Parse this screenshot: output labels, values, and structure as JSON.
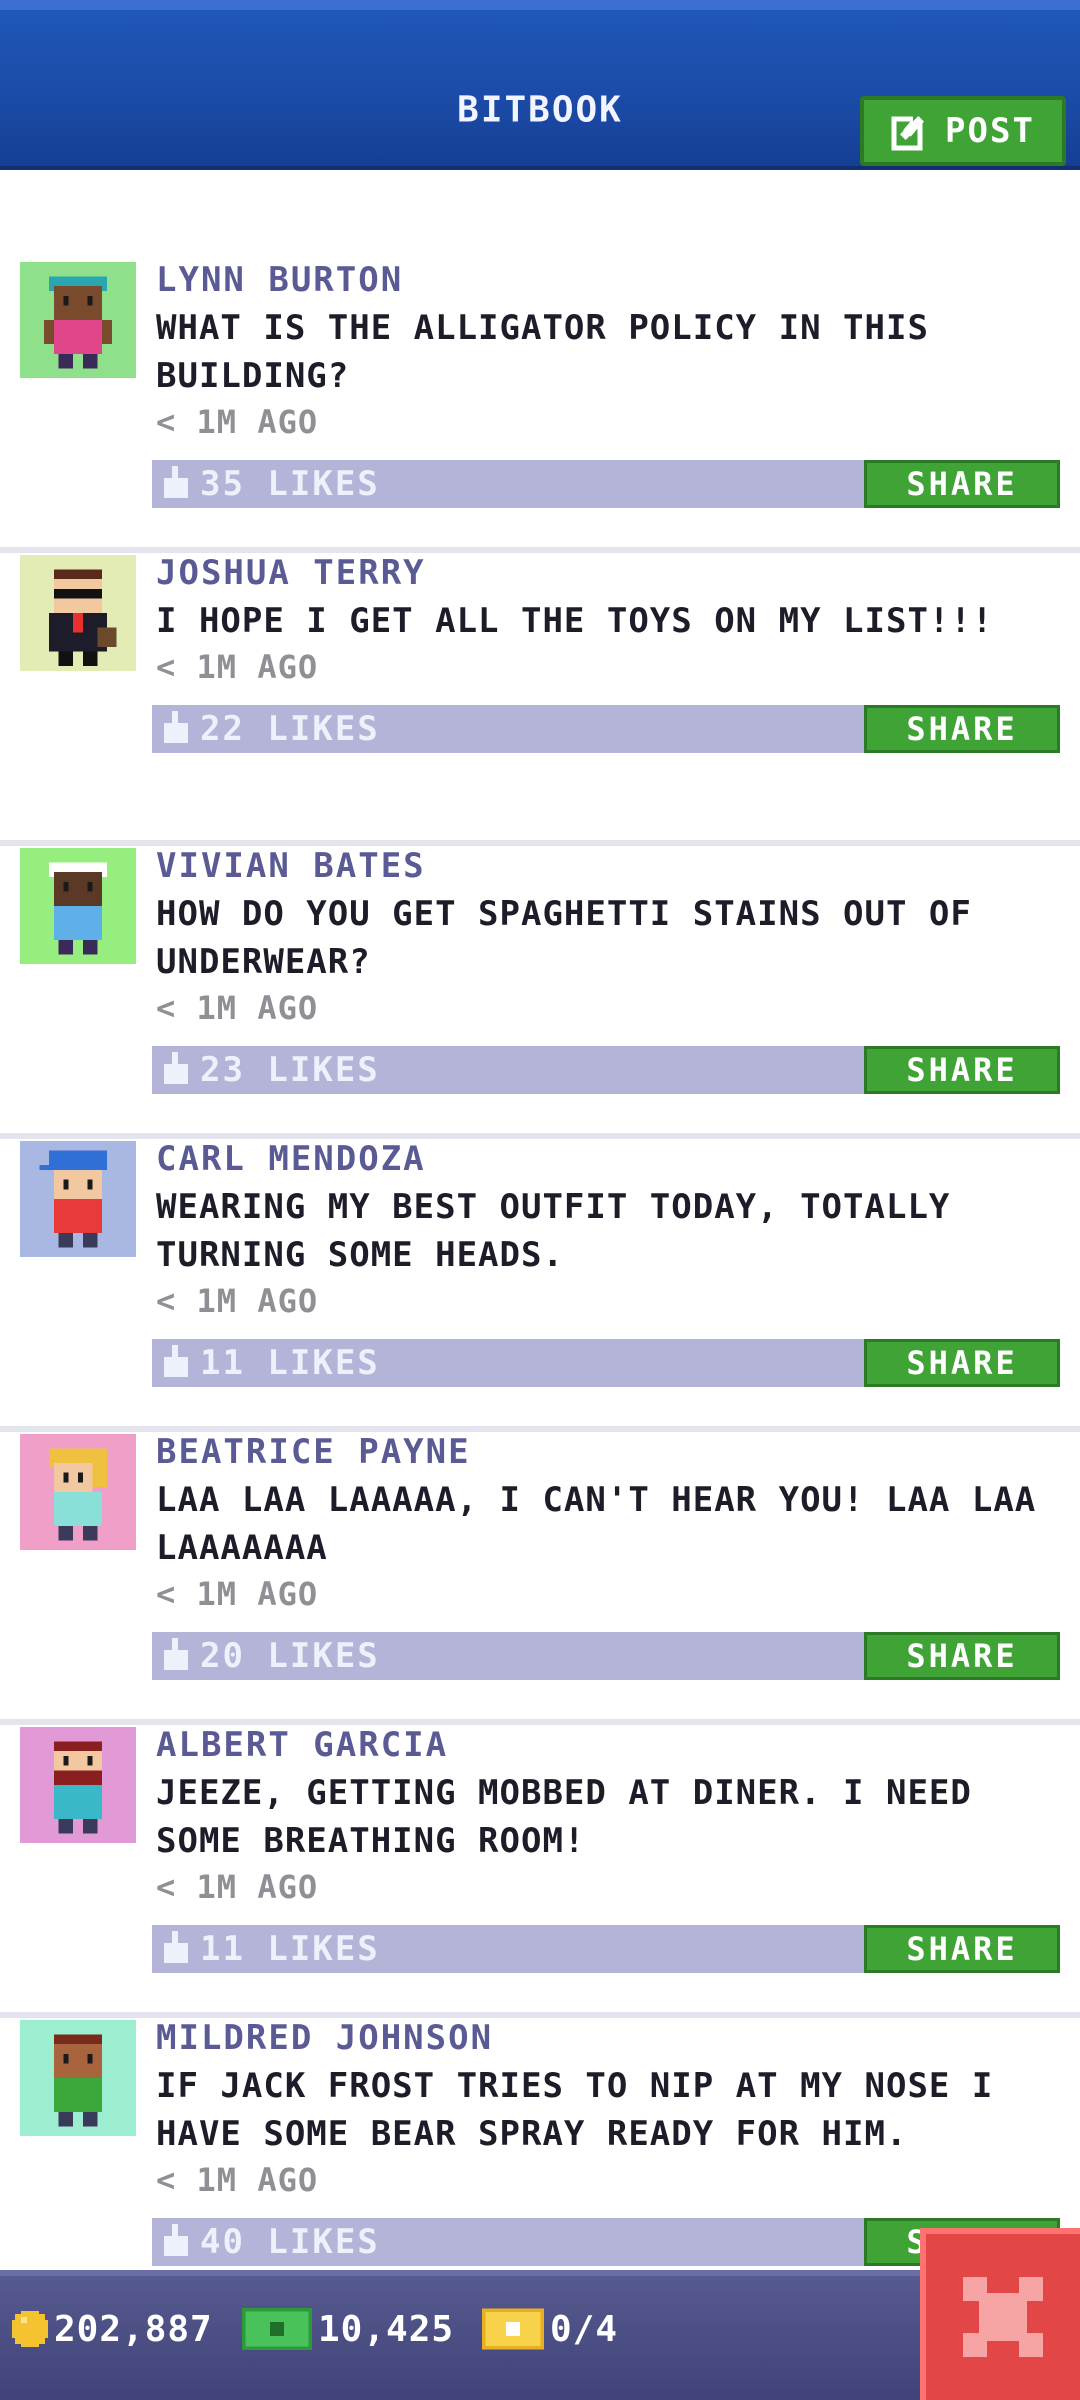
{
  "header": {
    "title": "BITBOOK",
    "post_label": "POST"
  },
  "colors": {
    "header_blue": "#1b4aa6",
    "green": "#3fa336",
    "likes_bar": "#b3b4d8",
    "close_red": "#e24646"
  },
  "posts": [
    {
      "author": "LYNN BURTON",
      "message": "WHAT IS THE ALLIGATOR POLICY IN THIS BUILDING?",
      "time": "< 1M AGO",
      "likes": "35 LIKES",
      "share": "SHARE",
      "avatar_bg": "#8fe08a",
      "avatar_icon": "woman-pink-shirt-avatar"
    },
    {
      "author": "JOSHUA TERRY",
      "message": "I HOPE I GET ALL THE TOYS ON MY LIST!!!",
      "time": "< 1M AGO",
      "likes": "22 LIKES",
      "share": "SHARE",
      "avatar_bg": "#e2ecb4",
      "avatar_icon": "man-sunglasses-suit-avatar"
    },
    {
      "author": "VIVIAN BATES",
      "message": "HOW DO YOU GET SPAGHETTI STAINS OUT OF UNDERWEAR?",
      "time": "< 1M AGO",
      "likes": "23 LIKES",
      "share": "SHARE",
      "avatar_bg": "#95ee7e",
      "avatar_icon": "woman-headband-avatar"
    },
    {
      "author": "CARL MENDOZA",
      "message": "WEARING MY BEST OUTFIT TODAY, TOTALLY TURNING SOME HEADS.",
      "time": "< 1M AGO",
      "likes": "11 LIKES",
      "share": "SHARE",
      "avatar_bg": "#a9b7e3",
      "avatar_icon": "man-blue-cap-avatar"
    },
    {
      "author": "BEATRICE PAYNE",
      "message": "LAA LAA LAAAAA, I CAN'T HEAR YOU! LAA LAA LAAAAAAA",
      "time": "< 1M AGO",
      "likes": "20 LIKES",
      "share": "SHARE",
      "avatar_bg": "#f0a0c8",
      "avatar_icon": "woman-blonde-avatar"
    },
    {
      "author": "ALBERT GARCIA",
      "message": "JEEZE, GETTING MOBBED AT DINER. I NEED SOME BREATHING ROOM!",
      "time": "< 1M AGO",
      "likes": "11 LIKES",
      "share": "SHARE",
      "avatar_bg": "#e29ad6",
      "avatar_icon": "man-beard-avatar"
    },
    {
      "author": "MILDRED JOHNSON",
      "message": "IF JACK FROST TRIES TO NIP AT MY NOSE I HAVE SOME BEAR SPRAY READY FOR HIM.",
      "time": "< 1M AGO",
      "likes": "40 LIKES",
      "share": "SHARE",
      "avatar_bg": "#9deed0",
      "avatar_icon": "woman-green-shirt-avatar"
    }
  ],
  "footer": {
    "coins": "202,887",
    "bux": "10,425",
    "tickets": "0/4"
  }
}
